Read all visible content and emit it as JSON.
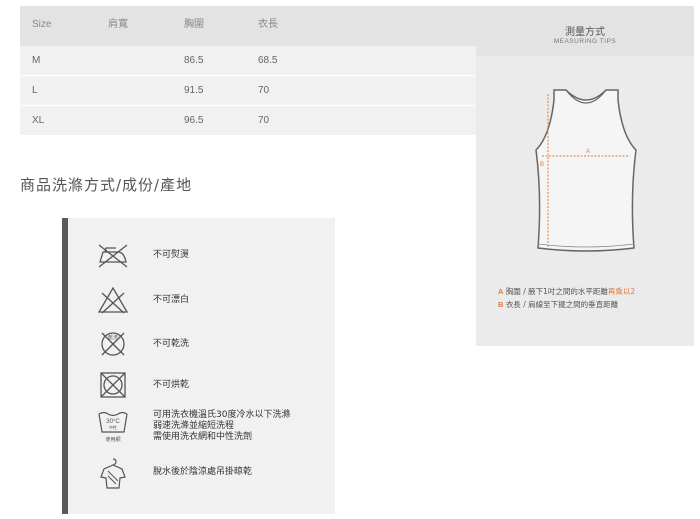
{
  "size_table": {
    "headers": [
      "Size",
      "肩寬",
      "胸圍",
      "衣長"
    ],
    "rows": [
      [
        "M",
        "",
        "86.5",
        "68.5"
      ],
      [
        "L",
        "",
        "91.5",
        "70"
      ],
      [
        "XL",
        "",
        "96.5",
        "70"
      ]
    ]
  },
  "care_section": {
    "title": "商品洗滌方式/成份/產地",
    "items": [
      {
        "icon": "no-iron-icon",
        "lines": [
          "不可熨燙"
        ]
      },
      {
        "icon": "no-bleach-icon",
        "lines": [
          "不可漂白"
        ]
      },
      {
        "icon": "no-dry-clean-icon",
        "icon_text": "乾洗",
        "lines": [
          "不可乾洗"
        ]
      },
      {
        "icon": "no-tumble-dry-icon",
        "lines": [
          "不可烘乾"
        ]
      },
      {
        "icon": "machine-wash-30-icon",
        "icon_text": "30°C",
        "icon_text2": "中性",
        "icon_caption": "使用網",
        "lines": [
          "可用洗衣機溫氏30度冷水以下洗滌",
          "弱速洗滌並縮短洗程",
          "需使用洗衣網和中性洗劑"
        ]
      },
      {
        "icon": "hang-dry-shade-icon",
        "lines": [
          "脫水後於陰涼處吊掛晾乾"
        ]
      }
    ]
  },
  "measuring": {
    "title": "測量方式",
    "subtitle": "MEASURING TIPS",
    "label_a": "A",
    "label_b": "B",
    "legend": [
      {
        "key": "A",
        "text": "胸圍 / 腋下1吋之間的水平距離",
        "accent": "再乘以2"
      },
      {
        "key": "B",
        "text": "衣長 / 肩線至下擺之間的垂直距離",
        "accent": ""
      }
    ]
  },
  "colors": {
    "accent": "#e07a3c",
    "bar": "#5a5a5a",
    "panel": "#f1f1f1"
  }
}
